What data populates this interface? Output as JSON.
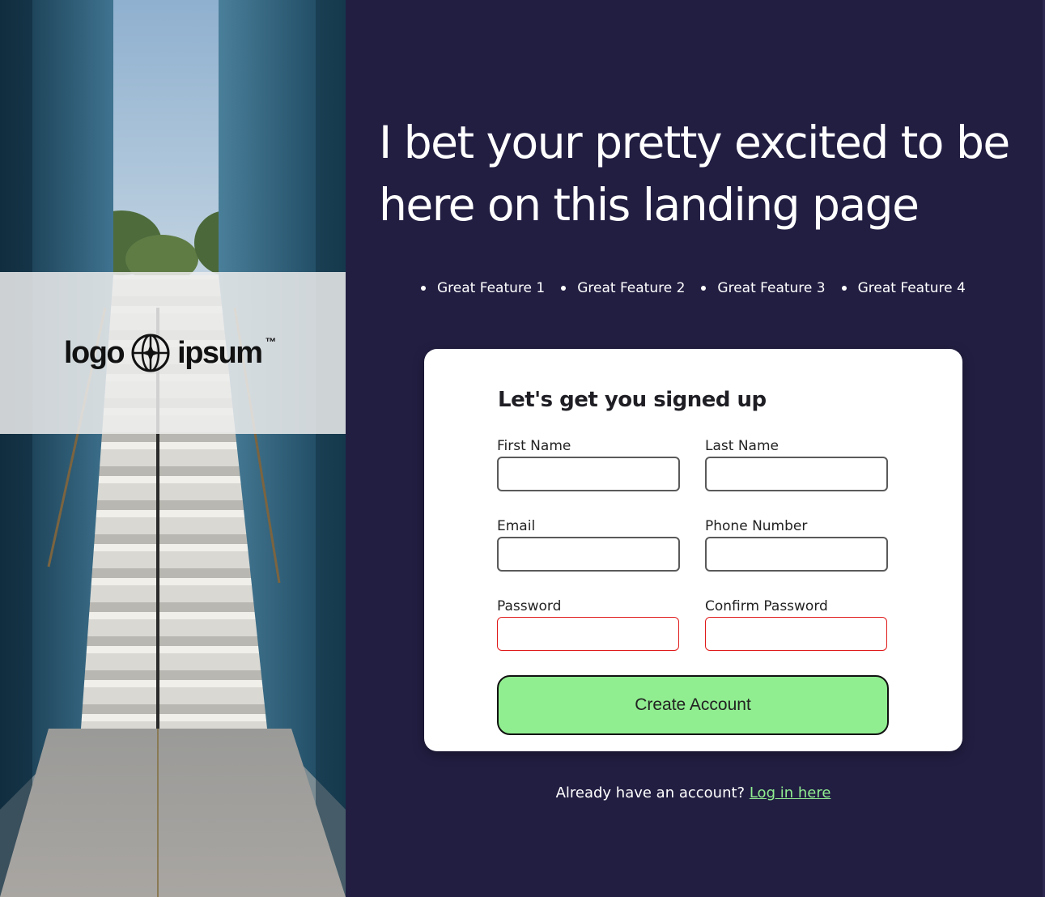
{
  "hero": {
    "logo": {
      "word_left": "logo",
      "word_right": "ipsum",
      "mark": "™",
      "icon": "globe-star-icon"
    },
    "image_description": "staircase-between-glass-walls"
  },
  "headline": "I bet your pretty excited to be here on this landing page",
  "features": [
    "Great Feature 1",
    "Great Feature 2",
    "Great Feature 3",
    "Great Feature 4"
  ],
  "form": {
    "title": "Let's get you signed up",
    "fields": {
      "first_name": {
        "label": "First Name",
        "value": ""
      },
      "last_name": {
        "label": "Last Name",
        "value": ""
      },
      "email": {
        "label": "Email",
        "value": ""
      },
      "phone": {
        "label": "Phone Number",
        "value": ""
      },
      "password": {
        "label": "Password",
        "value": "",
        "state": "invalid"
      },
      "confirm_password": {
        "label": "Confirm Password",
        "value": "",
        "state": "invalid"
      }
    },
    "submit_label": "Create Account"
  },
  "login_prompt": {
    "text": "Already have an account?",
    "link_label": "Log in here"
  },
  "colors": {
    "background": "#221e42",
    "accent": "#90ee90",
    "invalid_border": "#e01b1b",
    "card": "#ffffff"
  }
}
